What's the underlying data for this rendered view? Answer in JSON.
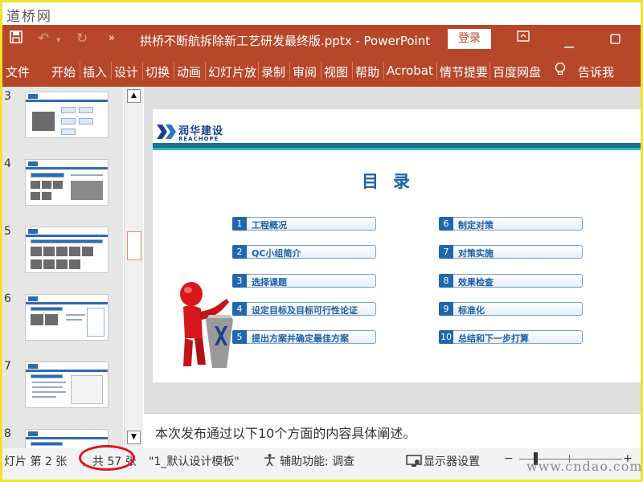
{
  "watermark_top": "道桥网",
  "watermark_bottom": "www.cndao.com",
  "titlebar": {
    "doc_title": "拱桥不断航拆除新工艺研发最终版.pptx  -  PowerPoint",
    "login_label": "登录",
    "save_icon": "save-icon",
    "undo_icon": "undo-icon",
    "redo_icon": "redo-icon",
    "more_icon": "more-icon",
    "ribbon_display_icon": "ribbon-display-icon",
    "minimize_icon": "minimize-icon",
    "restore_icon": "restore-icon"
  },
  "ribbon": {
    "tabs": [
      "文件",
      "开始",
      "插入",
      "设计",
      "切换",
      "动画",
      "幻灯片放",
      "录制",
      "审阅",
      "视图",
      "帮助",
      "Acrobat",
      "情节提要",
      "百度网盘"
    ],
    "tell_me": "告诉我",
    "tell_me_icon": "lightbulb-icon"
  },
  "thumbnails": [
    {
      "num": "3"
    },
    {
      "num": "4"
    },
    {
      "num": "5"
    },
    {
      "num": "6"
    },
    {
      "num": "7"
    },
    {
      "num": "8"
    }
  ],
  "slide": {
    "logo_cn": "润华建设",
    "logo_en": "REACHOPE",
    "heading": "目录",
    "items_left": [
      {
        "num": "1",
        "label": "工程概况"
      },
      {
        "num": "2",
        "label": "QC小组简介"
      },
      {
        "num": "3",
        "label": "选择课题"
      },
      {
        "num": "4",
        "label": "设定目标及目标可行性论证"
      },
      {
        "num": "5",
        "label": "提出方案并确定最佳方案"
      }
    ],
    "items_right": [
      {
        "num": "6",
        "label": "制定对策"
      },
      {
        "num": "7",
        "label": "对策实施"
      },
      {
        "num": "8",
        "label": "效果检查"
      },
      {
        "num": "9",
        "label": "标准化"
      },
      {
        "num": "10",
        "label": "总结和下一步打算"
      }
    ]
  },
  "notes": "本次发布通过以下10个方面的内容具体阐述。",
  "status": {
    "slide_info_a": "灯片 第 2 张",
    "slide_info_b": "，共 57 张",
    "template": "\"1_默认设计模板\"",
    "accessibility": "辅助功能: 调查",
    "display_settings": "显示器设置",
    "zoom_minus": "−",
    "zoom_plus": "+",
    "accessibility_icon": "accessibility-icon",
    "display_icon": "display-settings-icon"
  },
  "colors": {
    "ribbon": "#b7472a",
    "accent_blue": "#1d5fa8",
    "highlight_red": "#e0161c"
  }
}
